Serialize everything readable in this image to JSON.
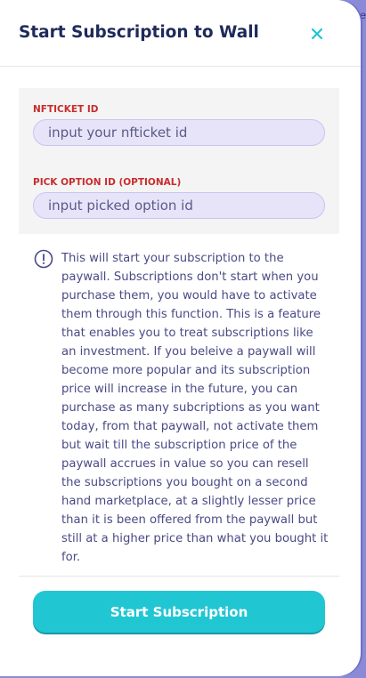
{
  "backdrop": {
    "edge_text": "e"
  },
  "modal": {
    "title": "Start Subscription to Wall",
    "close_icon": "close-icon",
    "fields": [
      {
        "label": "NFTICKET ID",
        "placeholder": "input your nfticket id"
      },
      {
        "label": "PICK OPTION ID (OPTIONAL)",
        "placeholder": "input picked option id"
      }
    ],
    "info": {
      "icon": "exclamation-circle-icon",
      "text": "This will start your subscription to the paywall. Subscriptions don't start when you purchase them, you would have to activate them through this function. This is a feature that enables you to treat subscriptions like an investment. If you beleive a paywall will become more popular and its subscription price will increase in the future, you can purchase as many subcriptions as you want today, from that paywall, not activate them but wait till the subscription price of the paywall accrues in value so you can resell the subscriptions you bought on a second hand marketplace, at a slightly lesser price than it is been offered from the paywall but still at a higher price than what you bought it for."
    },
    "submit_label": "Start Subscription"
  },
  "colors": {
    "accent": "#21c6d3",
    "title": "#1e2a5a",
    "label_red": "#c82d2d",
    "info_text": "#4a4a86",
    "input_bg": "#e7e4fa"
  }
}
